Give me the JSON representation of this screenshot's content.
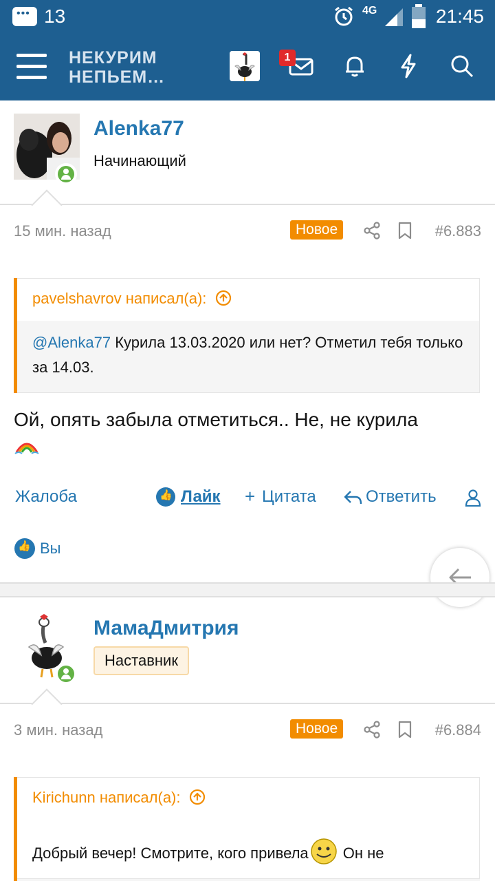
{
  "status_bar": {
    "notification_count": "13",
    "network": "4G",
    "time": "21:45"
  },
  "app_bar": {
    "logo_line1": "НЕКУРИМ",
    "logo_line2": "НЕПЬЕМ…",
    "inbox_badge": "1"
  },
  "posts": [
    {
      "username": "Alenka77",
      "user_title": "Начинающий",
      "time_ago": "15 мин. назад",
      "new_label": "Новое",
      "post_number": "#6.883",
      "quote": {
        "author_line": "pavelshavrov написал(а):",
        "mention": "@Alenka77",
        "text": " Курила 13.03.2020 или нет? Отметил тебя только за 14.03."
      },
      "message": "Ой, опять забыла отметиться.. Не, не курила",
      "actions": {
        "report": "Жалоба",
        "like": "Лайк",
        "quote": "Цитата",
        "reply": "Ответить"
      },
      "likes_by": "Вы"
    },
    {
      "username": "МамаДмитрия",
      "user_title": "Наставник",
      "time_ago": "3 мин. назад",
      "new_label": "Новое",
      "post_number": "#6.884",
      "quote": {
        "author_line": "Kirichunn написал(а):",
        "text": "Добрый вечер! Смотрите, кого привела",
        "text_after_emoji": " Он не"
      }
    }
  ],
  "colors": {
    "header_blue": "#1e5f91",
    "link_blue": "#2577b1",
    "accent_orange": "#f28c00",
    "online_green": "#63b245"
  }
}
